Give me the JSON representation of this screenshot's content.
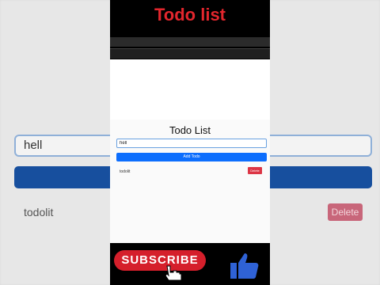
{
  "video_title": "Todo list",
  "app": {
    "heading": "Todo List",
    "input_value": "hell",
    "add_button_label": "Add Todo",
    "items": [
      {
        "text": "todolit",
        "delete_label": "Delete"
      }
    ]
  },
  "promo": {
    "subscribe_label": "SUBSCRIBE",
    "icons": [
      "thumbs-up-icon",
      "pointing-hand-icon"
    ]
  },
  "colors": {
    "title_red": "#e3262d",
    "primary_blue": "#0d6efd",
    "danger_red": "#dc3545",
    "subscribe_red": "#d51f2b",
    "thumb_blue": "#2f62d6"
  }
}
